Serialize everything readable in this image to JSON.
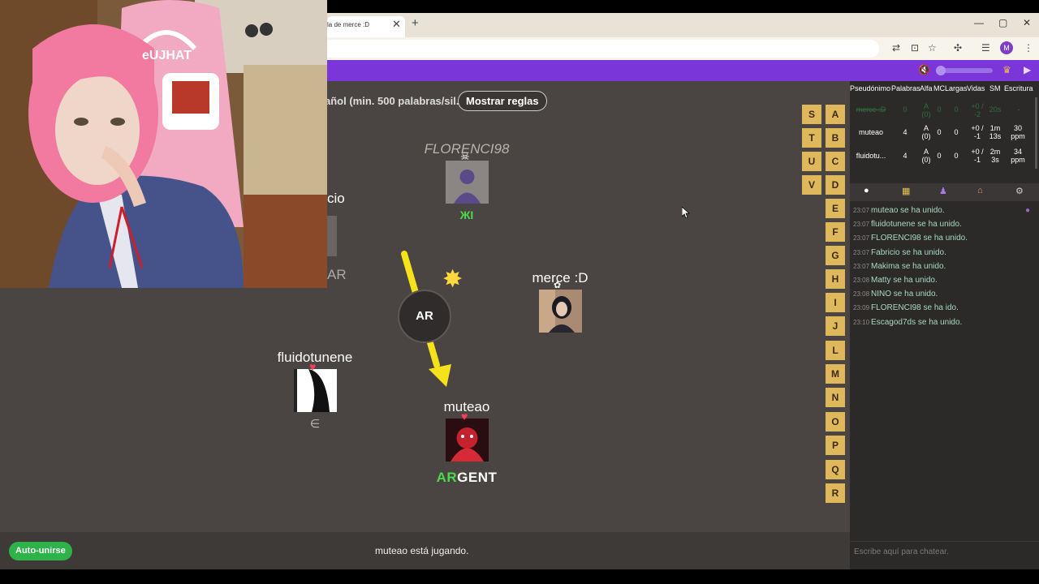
{
  "browser": {
    "tab_title": "la de merce :D",
    "tab_close": "✕",
    "new_tab": "+",
    "window_controls": [
      "—",
      "▢",
      "✕"
    ],
    "profile_initial": "M"
  },
  "game": {
    "rules_text": "añol (min. 500 palabras/sil.)",
    "rules_button": "Mostrar reglas",
    "prompt": "AR",
    "players": [
      {
        "name": "FLORENCI98",
        "status": "dead",
        "sub": "ЖI"
      },
      {
        "name": "merce :D",
        "status": "alive"
      },
      {
        "name": "fluidotunene",
        "status": "alive",
        "sub": "∈"
      },
      {
        "name": "muteao",
        "status": "alive",
        "current": true,
        "word_highlight": "AR",
        "word_rest": "GENT"
      }
    ],
    "partial_player": {
      "name_fragment": "cio",
      "word_fragment": "AR"
    },
    "letters_col1": [
      "S",
      "T",
      "U",
      "V"
    ],
    "letters_col2": [
      "A",
      "B",
      "C",
      "D",
      "E",
      "F",
      "G",
      "H",
      "I",
      "J",
      "L",
      "M",
      "N",
      "O",
      "P",
      "Q",
      "R"
    ]
  },
  "bottom": {
    "auto_join": "Auto-unirse",
    "status": "muteao está jugando."
  },
  "stats": {
    "headers": [
      "Pseudónimo",
      "Palabras",
      "Alfa",
      "MC",
      "Largas",
      "Vidas",
      "SM",
      "Escritura"
    ],
    "rows": [
      {
        "name": "merce :D",
        "words": "0",
        "alpha": "A (0)",
        "mc": "0",
        "long": "0",
        "lives": "+0 / -2",
        "sm": "20s",
        "speed": "-",
        "out": true
      },
      {
        "name": "muteao",
        "words": "4",
        "alpha": "A (0)",
        "mc": "0",
        "long": "0",
        "lives": "+0 / -1",
        "sm": "1m 13s",
        "speed": "30 ppm"
      },
      {
        "name": "fluidotu...",
        "words": "4",
        "alpha": "A (0)",
        "mc": "0",
        "long": "0",
        "lives": "+0 / -1",
        "sm": "2m 3s",
        "speed": "34 ppm"
      }
    ]
  },
  "chat": {
    "messages": [
      {
        "time": "23:07",
        "text": "muteao se ha unido."
      },
      {
        "time": "23:07",
        "text": "fluidotunene se ha unido."
      },
      {
        "time": "23:07",
        "text": "FLORENCI98 se ha unido."
      },
      {
        "time": "23:07",
        "text": "Fabricio se ha unido."
      },
      {
        "time": "23:07",
        "text": "Makima se ha unido."
      },
      {
        "time": "23:08",
        "text": "Matty se ha unido."
      },
      {
        "time": "23:08",
        "text": "NINO se ha unido."
      },
      {
        "time": "23:09",
        "text": "FLORENCI98 se ha ido."
      },
      {
        "time": "23:10",
        "text": "Escagod7ds se ha unido."
      }
    ],
    "placeholder": "Escribe aquí para chatear."
  },
  "webcam": {
    "chair_brand": "eUJHAT"
  },
  "colors": {
    "purple_bar": "#7a36d9",
    "letter_tile": "#e0b85c",
    "highlight_green": "#4cd94c",
    "arrow_yellow": "#f5e21b"
  }
}
